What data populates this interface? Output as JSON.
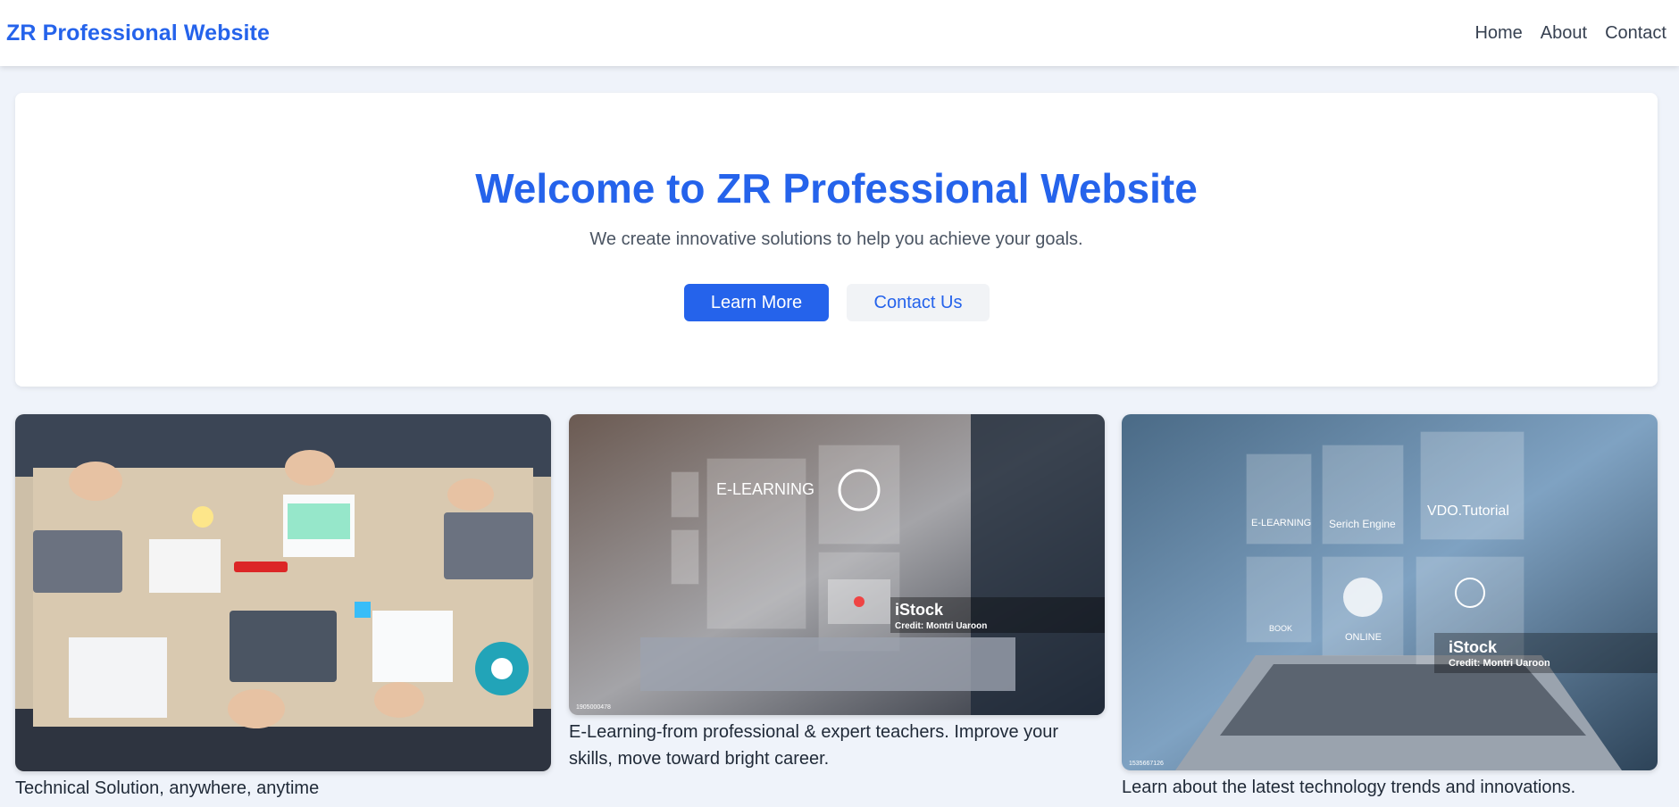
{
  "header": {
    "brand": "ZR Professional Website",
    "nav": [
      {
        "label": "Home"
      },
      {
        "label": "About"
      },
      {
        "label": "Contact"
      }
    ]
  },
  "hero": {
    "title": "Welcome to ZR Professional Website",
    "subtitle": "We create innovative solutions to help you achieve your goals.",
    "primary_button": "Learn More",
    "secondary_button": "Contact Us"
  },
  "cards": [
    {
      "caption": "Technical Solution, anywhere, anytime",
      "image_desc": "team-meeting-desk-photo"
    },
    {
      "caption": "E-Learning-from professional & expert teachers. Improve your skills, move toward bright career.",
      "image_desc": "e-learning-laptop-photo",
      "overlay": {
        "label": "E-LEARNING",
        "watermark": "iStock",
        "credit": "Credit: Montri Uaroon",
        "stock_id": "1905000478"
      }
    },
    {
      "caption": "Learn about the latest technology trends and innovations.",
      "image_desc": "technology-laptop-photo",
      "overlay": {
        "tiles": [
          "E-LEARNING",
          "Serich Engine",
          "VDO.Tutorial",
          "BOOK",
          "ONLINE"
        ],
        "watermark": "iStock",
        "credit": "Credit: Montri Uaroon",
        "stock_id": "1535667126"
      }
    }
  ],
  "colors": {
    "brand": "#2563eb",
    "page_bg": "#eff3fa",
    "card_bg": "#ffffff"
  }
}
